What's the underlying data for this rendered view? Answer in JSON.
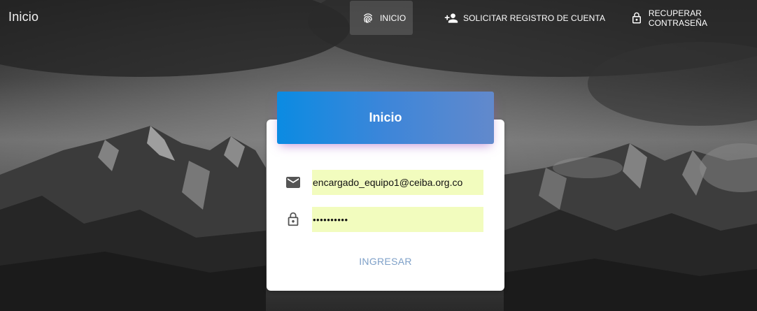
{
  "topbar": {
    "brand": "Inicio",
    "nav": [
      {
        "label": "INICIO",
        "icon": "fingerprint-icon",
        "active": true
      },
      {
        "label": "SOLICITAR REGISTRO DE CUENTA",
        "icon": "person-add-icon",
        "active": false
      },
      {
        "label": "RECUPERAR CONTRASEÑA",
        "icon": "lock-open-icon",
        "active": false
      }
    ]
  },
  "login_card": {
    "title": "Inicio",
    "email": {
      "icon": "mail-icon",
      "value": "encargado_equipo1@ceiba.org.co"
    },
    "password": {
      "icon": "lock-icon",
      "value": "••••••••••"
    },
    "submit_label": "INGRESAR"
  },
  "colors": {
    "header_gradient_start": "#0b8be2",
    "header_gradient_end": "#6289cc",
    "input_autofill_bg": "#f2fcbe",
    "submit_text": "#7ea0c8"
  }
}
